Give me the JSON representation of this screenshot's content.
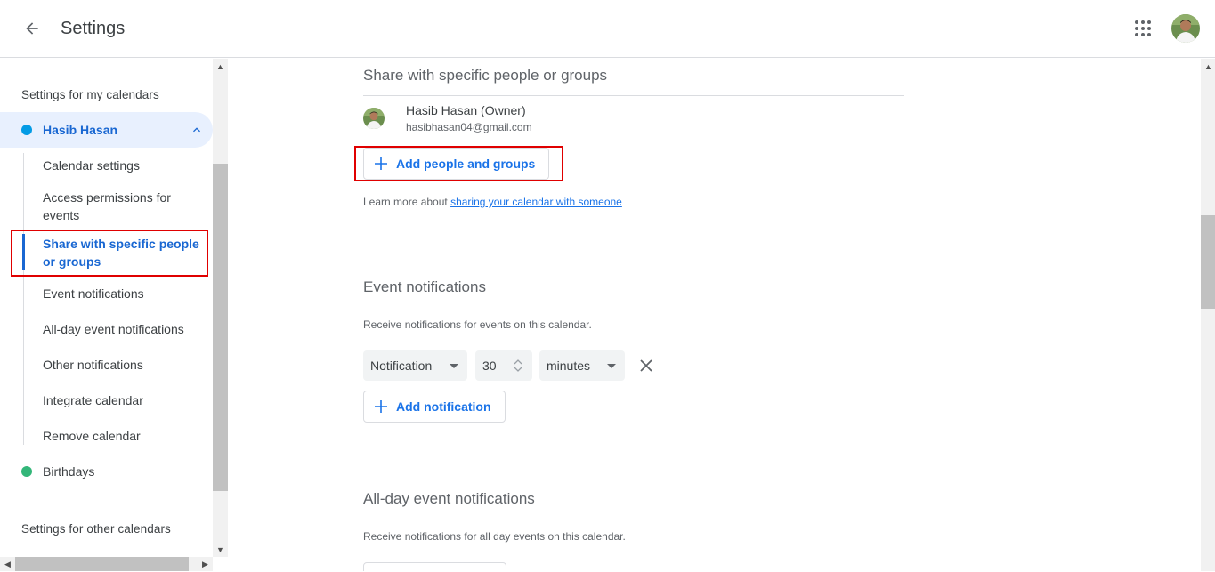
{
  "header": {
    "title": "Settings"
  },
  "sidebar": {
    "my_calendars_heading": "Settings for my calendars",
    "other_calendars_heading": "Settings for other calendars",
    "calendars": [
      {
        "name": "Hasib Hasan",
        "color": "#039be5",
        "active": true
      },
      {
        "name": "Birthdays",
        "color": "#33b679",
        "active": false
      }
    ],
    "sub_items": [
      {
        "label": "Calendar settings"
      },
      {
        "label": "Access permissions for events"
      },
      {
        "label": "Share with specific people or groups",
        "active": true
      },
      {
        "label": "Event notifications"
      },
      {
        "label": "All-day event notifications"
      },
      {
        "label": "Other notifications"
      },
      {
        "label": "Integrate calendar"
      },
      {
        "label": "Remove calendar"
      }
    ]
  },
  "main": {
    "share": {
      "title": "Share with specific people or groups",
      "person_name": "Hasib Hasan (Owner)",
      "person_email": "hasibhasan04@gmail.com",
      "add_button": "Add people and groups",
      "help_prefix": "Learn more about ",
      "help_link": "sharing your calendar with someone"
    },
    "event_notifications": {
      "title": "Event notifications",
      "description": "Receive notifications for events on this calendar.",
      "type": "Notification",
      "amount": "30",
      "unit": "minutes",
      "add_button": "Add notification"
    },
    "allday_notifications": {
      "title": "All-day event notifications",
      "description": "Receive notifications for all day events on this calendar."
    }
  },
  "colors": {
    "accent": "#1a73e8",
    "active_text": "#1967d2",
    "active_bg": "#e8f0fe",
    "highlight": "#e00000"
  }
}
